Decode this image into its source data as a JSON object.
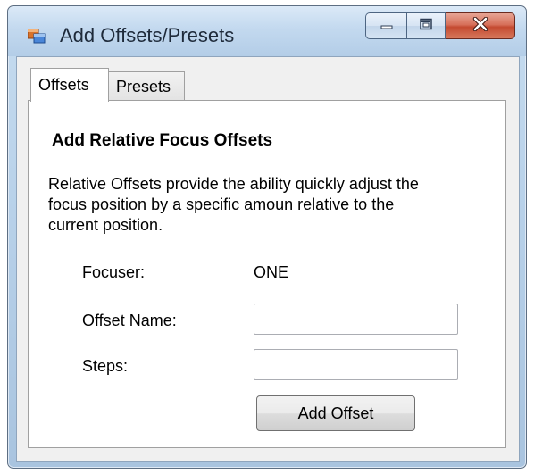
{
  "window": {
    "title": "Add Offsets/Presets",
    "icon": "app-window-icon",
    "caption_buttons": [
      "minimize-icon",
      "maximize-icon",
      "close-icon"
    ]
  },
  "tabs": [
    {
      "label": "Offsets",
      "active": true
    },
    {
      "label": "Presets",
      "active": false
    }
  ],
  "offsets_page": {
    "heading": "Add Relative Focus Offsets",
    "description_lines": [
      "Relative Offsets provide the ability quickly adjust the",
      "focus position by a specific amoun relative to the",
      "current position."
    ],
    "focuser_label": "Focuser:",
    "focuser_value": "ONE",
    "offset_name_label": "Offset Name:",
    "offset_name_value": "",
    "steps_label": "Steps:",
    "steps_value": "",
    "add_button_label": "Add Offset"
  },
  "colors": {
    "window_frame": "#b9d2ea",
    "close_button": "#c44a30",
    "tab_page_bg": "#ffffff",
    "client_bg": "#f0f0f0"
  }
}
